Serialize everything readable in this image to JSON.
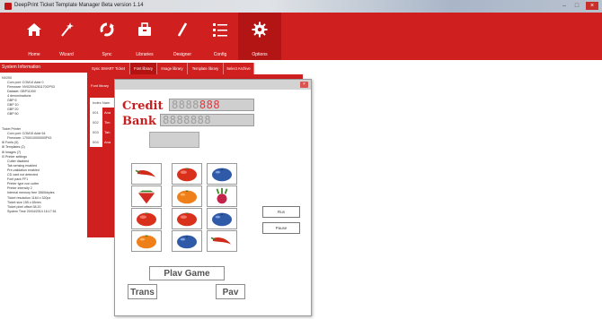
{
  "window": {
    "title": "DeepPrint    Ticket Template Manager Beta version 1.14",
    "controls": [
      "–",
      "□",
      "×"
    ]
  },
  "ribbon": {
    "accent": "#cf1f1f",
    "tools": [
      {
        "label": "Home",
        "icon": "home-icon"
      },
      {
        "label": "Wizard",
        "icon": "wand-icon"
      },
      {
        "label": "Sync",
        "icon": "sync-icon"
      },
      {
        "label": "Libraries",
        "icon": "briefcase-icon"
      },
      {
        "label": "Designer",
        "icon": "pen-icon"
      },
      {
        "label": "Config",
        "icon": "list-icon"
      },
      {
        "label": "Options",
        "icon": "gear-icon"
      }
    ]
  },
  "left_panel": {
    "header": "System Information",
    "lines": [
      "NV200",
      "Com port: COM14 Addr 0",
      "Firmware: NV02004281170OP03",
      "Dataset: GBP11000",
      "4 denominations",
      "GBP 5",
      "GBP 10",
      "GBP 20",
      "GBP 50",
      "",
      "Ticket Printer",
      "Com port: COM15 Addr 64",
      "Firmware: 1700010000000P43",
      "⊞ Fonts (5)",
      "⊞ Templates (2)",
      "⊞ Images (7)",
      "⊟ Printer settings",
      "Cutter disabled",
      "Tab sensing enabled",
      "Pre-validation enabled",
      "CD card not detected",
      "Font pack FF1",
      "Printer type non cutter",
      "Printer intensity 2",
      "Internal memory free 1560kbytes",
      "Ticket resolution 1164 x 320px",
      "Ticket size 155 x 65mm",
      "Ticket pixel offset 38.20",
      "System Time 20/04/2014 16:17:51"
    ]
  },
  "tabs": [
    "Sync SMART Ticket",
    "Font library",
    "Image library",
    "Template library",
    "Select Archive"
  ],
  "content": {
    "subhead": "Font library",
    "grid_header": "Index  Nam",
    "rows": [
      {
        "index": "001",
        "name": "Ana"
      },
      {
        "index": "002",
        "name": "Tim"
      },
      {
        "index": "003",
        "name": "Tah"
      },
      {
        "index": "004",
        "name": "Ana"
      }
    ]
  },
  "dialog": {
    "close_glyph": "×",
    "credit_label": "Credit",
    "credit_digits": "8888",
    "credit_value": "888",
    "bank_label": "Bank",
    "bank_digits": "8888888",
    "reels": [
      [
        "chili",
        "tomato",
        "blueberry"
      ],
      [
        "strawberry",
        "orange",
        "radish"
      ],
      [
        "tomato",
        "tomato",
        "blueberry"
      ],
      [
        "orange",
        "blueberry",
        "chili"
      ]
    ],
    "run_label": "Run",
    "pause_label": "Pause",
    "play_label": "Plav Game",
    "trans_label": "Trans",
    "pay_label": "Pav"
  }
}
